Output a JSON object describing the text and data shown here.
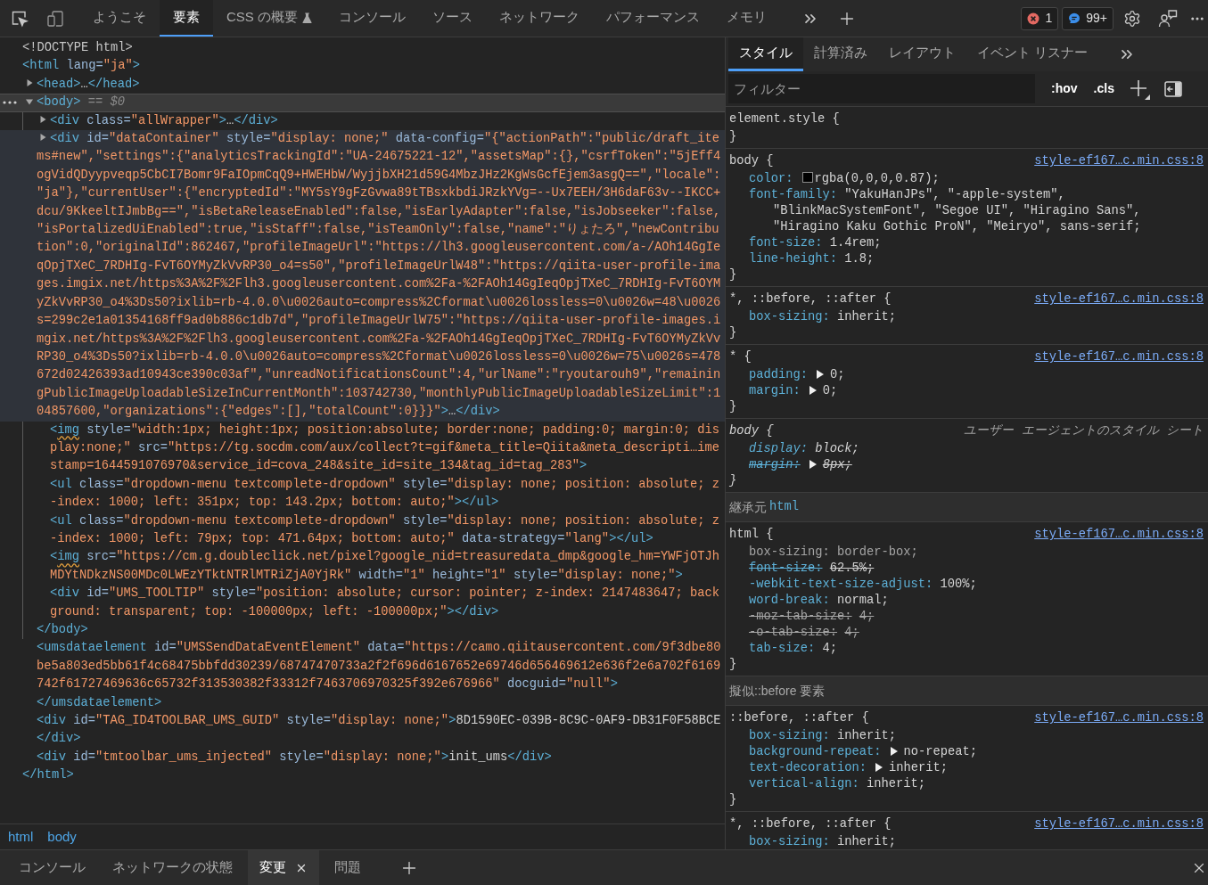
{
  "top_bar": {
    "tabs": [
      {
        "label": "ようこそ",
        "selected": false,
        "experimental": false
      },
      {
        "label": "要素",
        "selected": true,
        "experimental": false
      },
      {
        "label": "CSS の概要",
        "selected": false,
        "experimental": true
      },
      {
        "label": "コンソール",
        "selected": false,
        "experimental": false
      },
      {
        "label": "ソース",
        "selected": false,
        "experimental": false
      },
      {
        "label": "ネットワーク",
        "selected": false,
        "experimental": false
      },
      {
        "label": "パフォーマンス",
        "selected": false,
        "experimental": false
      },
      {
        "label": "メモリ",
        "selected": false,
        "experimental": false
      }
    ],
    "error_count": "1",
    "message_count": "99+"
  },
  "dom_tree": [
    {
      "segments": [
        {
          "kind": "doctype",
          "text": "<!DOCTYPE html>"
        }
      ],
      "selected": false,
      "hovered": false,
      "issue": false
    },
    {
      "segments": [
        {
          "kind": "tag",
          "text": "<html"
        },
        {
          "kind": "attr",
          "text": " lang="
        },
        {
          "kind": "value",
          "text": "\"ja\""
        },
        {
          "kind": "tag",
          "text": ">"
        }
      ],
      "selected": false,
      "hovered": false,
      "issue": false,
      "children": [
        {
          "expanded": false,
          "segments": [
            {
              "kind": "tag",
              "text": "<head>"
            },
            {
              "kind": "text",
              "text": "…"
            },
            {
              "kind": "tag",
              "text": "</head>"
            }
          ],
          "selected": false,
          "hovered": false,
          "issue": false
        },
        {
          "expanded": true,
          "segments": [
            {
              "kind": "tag",
              "text": "<body>"
            },
            {
              "kind": "hint",
              "text": " == $0"
            }
          ],
          "selected": true,
          "hovered": false,
          "issue": false,
          "children": [
            {
              "expanded": false,
              "segments": [
                {
                  "kind": "tag",
                  "text": "<div"
                },
                {
                  "kind": "attr",
                  "text": " class="
                },
                {
                  "kind": "value",
                  "text": "\"allWrapper\""
                },
                {
                  "kind": "tag",
                  "text": ">"
                },
                {
                  "kind": "text",
                  "text": "…"
                },
                {
                  "kind": "tag",
                  "text": "</div>"
                }
              ],
              "selected": false,
              "hovered": false,
              "issue": false
            },
            {
              "expanded": false,
              "segments": [
                {
                  "kind": "tag",
                  "text": "<div"
                },
                {
                  "kind": "attr",
                  "text": " id="
                },
                {
                  "kind": "value",
                  "text": "\"dataContainer\""
                },
                {
                  "kind": "attr",
                  "text": " style="
                },
                {
                  "kind": "value",
                  "text": "\"display: none;\""
                },
                {
                  "kind": "attr",
                  "text": " data-config="
                },
                {
                  "kind": "value",
                  "text": "\"{\"actionPath\":\"public/draft_items#new\",\"settings\":{\"analyticsTrackingId\":\"UA-24675221-12\",\"assetsMap\":{},\"csrfToken\":\"5jEff4ogVidQDyypveqp5CbCI7Bomr9FaIOpmCqQ9+HWEHbW/WyjjbXH21d59G4MbzJHz2KgWsGcfEjem3asgQ==\",\"locale\":\"ja\"},\"currentUser\":{\"encryptedId\":\"MY5sY9gFzGvwa89tTBsxkbdiJRzkYVg=--Ux7EEH/3H6daF63v--IKCC+dcu/9KkeeltIJmbBg==\",\"isBetaReleaseEnabled\":false,\"isEarlyAdapter\":false,\"isJobseeker\":false,\"isPortalizedUiEnabled\":true,\"isStaff\":false,\"isTeamOnly\":false,\"name\":\"りょたろ\",\"newContribution\":0,\"originalId\":862467,\"profileImageUrl\":\"https://lh3.googleusercontent.com/a-/AOh14GgIeqOpjTXeC_7RDHIg-FvT6OYMyZkVvRP30_o4=s50\",\"profileImageUrlW48\":\"https://qiita-user-profile-images.imgix.net/https%3A%2F%2Flh3.googleusercontent.com%2Fa-%2FAOh14GgIeqOpjTXeC_7RDHIg-FvT6OYMyZkVvRP30_o4%3Ds50?ixlib=rb-4.0.0\\u0026auto=compress%2Cformat\\u0026lossless=0\\u0026w=48\\u0026s=299c2e1a01354168ff9ad0b886c1db7d\",\"profileImageUrlW75\":\"https://qiita-user-profile-images.imgix.net/https%3A%2F%2Flh3.googleusercontent.com%2Fa-%2FAOh14GgIeqOpjTXeC_7RDHIg-FvT6OYMyZkVvRP30_o4%3Ds50?ixlib=rb-4.0.0\\u0026auto=compress%2Cformat\\u0026lossless=0\\u0026w=75\\u0026s=478672d02426393ad10943ce390c03af\",\"unreadNotificationsCount\":4,\"urlName\":\"ryoutarouh9\",\"remainingPublicImageUploadableSizeInCurrentMonth\":103742730,\"monthlyPublicImageUploadableSizeLimit\":104857600,\"organizations\":{\"edges\":[],\"totalCount\":0}}}\""
                },
                {
                  "kind": "tag",
                  "text": ">"
                },
                {
                  "kind": "text",
                  "text": "…"
                },
                {
                  "kind": "tag",
                  "text": "</div>"
                }
              ],
              "selected": false,
              "hovered": true,
              "issue": false
            },
            {
              "segments": [
                {
                  "kind": "tag",
                  "text": "<img"
                },
                {
                  "kind": "attr",
                  "text": " style="
                },
                {
                  "kind": "value",
                  "text": "\"width:1px; height:1px; position:absolute; border:none; padding:0; margin:0; display:none;\""
                },
                {
                  "kind": "attr",
                  "text": " src="
                },
                {
                  "kind": "value",
                  "text": "\"https://tg.socdm.com/aux/collect?t=gif&meta_title=Qiita&meta_descripti…imestamp=1644591076970&service_id=cova_248&site_id=site_134&tag_id=tag_283\""
                },
                {
                  "kind": "tag",
                  "text": ">"
                }
              ],
              "selected": false,
              "hovered": false,
              "issue": true
            },
            {
              "segments": [
                {
                  "kind": "tag",
                  "text": "<ul"
                },
                {
                  "kind": "attr",
                  "text": " class="
                },
                {
                  "kind": "value",
                  "text": "\"dropdown-menu textcomplete-dropdown\""
                },
                {
                  "kind": "attr",
                  "text": " style="
                },
                {
                  "kind": "value",
                  "text": "\"display: none; position: absolute; z-index: 1000; left: 351px; top: 143.2px; bottom: auto;\""
                },
                {
                  "kind": "tag",
                  "text": "></ul>"
                }
              ],
              "selected": false,
              "hovered": false,
              "issue": false
            },
            {
              "segments": [
                {
                  "kind": "tag",
                  "text": "<ul"
                },
                {
                  "kind": "attr",
                  "text": " class="
                },
                {
                  "kind": "value",
                  "text": "\"dropdown-menu textcomplete-dropdown\""
                },
                {
                  "kind": "attr",
                  "text": " style="
                },
                {
                  "kind": "value",
                  "text": "\"display: none; position: absolute; z-index: 1000; left: 79px; top: 471.64px; bottom: auto;\""
                },
                {
                  "kind": "attr",
                  "text": " data-strategy="
                },
                {
                  "kind": "value",
                  "text": "\"lang\""
                },
                {
                  "kind": "tag",
                  "text": "></ul>"
                }
              ],
              "selected": false,
              "hovered": false,
              "issue": false
            },
            {
              "segments": [
                {
                  "kind": "tag",
                  "text": "<img"
                },
                {
                  "kind": "attr",
                  "text": " src="
                },
                {
                  "kind": "value",
                  "text": "\"https://cm.g.doubleclick.net/pixel?google_nid=treasuredata_dmp&google_hm=YWFjOTJhMDYtNDkzNS00MDc0LWEzYTktNTRlMTRiZjA0YjRk\""
                },
                {
                  "kind": "attr",
                  "text": " width="
                },
                {
                  "kind": "value",
                  "text": "\"1\""
                },
                {
                  "kind": "attr",
                  "text": " height="
                },
                {
                  "kind": "value",
                  "text": "\"1\""
                },
                {
                  "kind": "attr",
                  "text": " style="
                },
                {
                  "kind": "value",
                  "text": "\"display: none;\""
                },
                {
                  "kind": "tag",
                  "text": ">"
                }
              ],
              "selected": false,
              "hovered": false,
              "issue": true
            },
            {
              "segments": [
                {
                  "kind": "tag",
                  "text": "<div"
                },
                {
                  "kind": "attr",
                  "text": " id="
                },
                {
                  "kind": "value",
                  "text": "\"UMS_TOOLTIP\""
                },
                {
                  "kind": "attr",
                  "text": " style="
                },
                {
                  "kind": "value",
                  "text": "\"position: absolute; cursor: pointer; z-index: 2147483647; background: transparent; top: -100000px; left: -100000px;\""
                },
                {
                  "kind": "tag",
                  "text": "></div>"
                }
              ],
              "selected": false,
              "hovered": false,
              "issue": false
            }
          ],
          "closing": [
            {
              "kind": "tag",
              "text": "</body>"
            }
          ]
        },
        {
          "segments": [
            {
              "kind": "tag",
              "text": "<umsdataelement"
            },
            {
              "kind": "attr",
              "text": " id="
            },
            {
              "kind": "value",
              "text": "\"UMSSendDataEventElement\""
            },
            {
              "kind": "attr",
              "text": " data="
            },
            {
              "kind": "value",
              "text": "\"https://camo.qiitausercontent.com/9f3dbe80be5a803ed5bb61f4c68475bbfdd30239/68747470733a2f2f696d6167652e69746d656469612e636f2e6a702f6169742f61727469636c65732f313530382f33312f7463706970325f392e676966\""
            },
            {
              "kind": "attr",
              "text": " docguid="
            },
            {
              "kind": "value",
              "text": "\"null\""
            },
            {
              "kind": "tag",
              "text": ">"
            }
          ],
          "selected": false,
          "hovered": false,
          "issue": false,
          "closing": [
            {
              "kind": "tag",
              "text": "</umsdataelement>"
            }
          ]
        },
        {
          "segments": [
            {
              "kind": "tag",
              "text": "<div"
            },
            {
              "kind": "attr",
              "text": " id="
            },
            {
              "kind": "value",
              "text": "\"TAG_ID4TOOLBAR_UMS_GUID\""
            },
            {
              "kind": "attr",
              "text": " style="
            },
            {
              "kind": "value",
              "text": "\"display: none;\""
            },
            {
              "kind": "tag",
              "text": ">"
            },
            {
              "kind": "text",
              "text": "8D1590EC-039B-8C9C-0AF9-DB31F0F58BCE"
            }
          ],
          "selected": false,
          "hovered": false,
          "issue": false,
          "closing": [
            {
              "kind": "tag",
              "text": "</div>"
            }
          ]
        },
        {
          "segments": [
            {
              "kind": "tag",
              "text": "<div"
            },
            {
              "kind": "attr",
              "text": " id="
            },
            {
              "kind": "value",
              "text": "\"tmtoolbar_ums_injected\""
            },
            {
              "kind": "attr",
              "text": " style="
            },
            {
              "kind": "value",
              "text": "\"display: none;\""
            },
            {
              "kind": "tag",
              "text": ">"
            },
            {
              "kind": "text",
              "text": "init_ums"
            },
            {
              "kind": "tag",
              "text": "</div>"
            }
          ],
          "selected": false,
          "hovered": false,
          "issue": false
        }
      ],
      "closing": [
        {
          "kind": "tag",
          "text": "</html>"
        }
      ]
    }
  ],
  "breadcrumbs": [
    "html",
    "body"
  ],
  "styles_pane": {
    "tabs": [
      {
        "label": "スタイル",
        "selected": true
      },
      {
        "label": "計算済み",
        "selected": false
      },
      {
        "label": "レイアウト",
        "selected": false
      },
      {
        "label": "イベント リスナー",
        "selected": false
      }
    ],
    "filter": {
      "placeholder": "フィルター"
    },
    "toggles": [
      ":hov",
      ".cls"
    ],
    "blocks": [
      {
        "kind": "rule",
        "user_agent": false,
        "selector": "element.style {",
        "end": "}"
      },
      {
        "kind": "rule",
        "user_agent": false,
        "selector": "body {",
        "source": "style-ef167…c.min.css:8",
        "end": "}",
        "properties": [
          {
            "name": "color:",
            "value": "rgba(0,0,0,0.87);",
            "color": "#000000",
            "struck": false,
            "inactive": false,
            "expandable": false
          },
          {
            "name": "font-family:",
            "value": "\"YakuHanJPs\", \"-apple-system\", \"BlinkMacSystemFont\", \"Segoe UI\", \"Hiragino Sans\", \"Hiragino Kaku Gothic ProN\", \"Meiryo\", sans-serif;",
            "struck": false,
            "inactive": false,
            "expandable": false
          },
          {
            "name": "font-size:",
            "value": "1.4rem;",
            "struck": false,
            "inactive": false,
            "expandable": false
          },
          {
            "name": "line-height:",
            "value": "1.8;",
            "struck": false,
            "inactive": false,
            "expandable": false
          }
        ]
      },
      {
        "kind": "rule",
        "user_agent": false,
        "selector": "*, ::before, ::after {",
        "source": "style-ef167…c.min.css:8",
        "end": "}",
        "properties": [
          {
            "name": "box-sizing:",
            "value": "inherit;",
            "struck": false,
            "inactive": false,
            "expandable": false
          }
        ]
      },
      {
        "kind": "rule",
        "user_agent": false,
        "selector": "* {",
        "source": "style-ef167…c.min.css:8",
        "end": "}",
        "properties": [
          {
            "name": "padding:",
            "value": "0;",
            "struck": false,
            "inactive": false,
            "expandable": true
          },
          {
            "name": "margin:",
            "value": "0;",
            "struck": false,
            "inactive": false,
            "expandable": true
          }
        ]
      },
      {
        "kind": "rule",
        "user_agent": true,
        "selector": "body {",
        "source": "ユーザー エージェントのスタイル シート",
        "end": "}",
        "properties": [
          {
            "name": "display:",
            "value": "block;",
            "struck": false,
            "inactive": false,
            "expandable": false
          },
          {
            "name": "margin:",
            "value": "8px;",
            "struck": true,
            "inactive": false,
            "expandable": true
          }
        ]
      },
      {
        "kind": "header",
        "label": "継承元",
        "link": "html"
      },
      {
        "kind": "rule",
        "user_agent": false,
        "selector": "html {",
        "source": "style-ef167…c.min.css:8",
        "end": "}",
        "properties": [
          {
            "name": "box-sizing:",
            "value": "border-box;",
            "struck": false,
            "inactive": true,
            "expandable": false
          },
          {
            "name": "font-size:",
            "value": "62.5%;",
            "struck": true,
            "inactive": false,
            "expandable": false
          },
          {
            "name": "-webkit-text-size-adjust:",
            "value": "100%;",
            "struck": false,
            "inactive": false,
            "expandable": false
          },
          {
            "name": "word-break:",
            "value": "normal;",
            "struck": false,
            "inactive": false,
            "expandable": false
          },
          {
            "name": "-moz-tab-size:",
            "value": "4;",
            "struck": true,
            "inactive": true,
            "expandable": false
          },
          {
            "name": "-o-tab-size:",
            "value": "4;",
            "struck": true,
            "inactive": true,
            "expandable": false
          },
          {
            "name": "tab-size:",
            "value": "4;",
            "struck": false,
            "inactive": false,
            "expandable": false
          }
        ]
      },
      {
        "kind": "header",
        "label": "擬似::before 要素"
      },
      {
        "kind": "rule",
        "user_agent": false,
        "selector": "::before, ::after {",
        "source": "style-ef167…c.min.css:8",
        "end": "}",
        "properties": [
          {
            "name": "box-sizing:",
            "value": "inherit;",
            "struck": false,
            "inactive": false,
            "expandable": false
          },
          {
            "name": "background-repeat:",
            "value": "no-repeat;",
            "struck": false,
            "inactive": false,
            "expandable": true
          },
          {
            "name": "text-decoration:",
            "value": "inherit;",
            "struck": false,
            "inactive": false,
            "expandable": true
          },
          {
            "name": "vertical-align:",
            "value": "inherit;",
            "struck": false,
            "inactive": false,
            "expandable": false
          }
        ]
      },
      {
        "kind": "rule",
        "user_agent": false,
        "selector": "*, ::before, ::after {",
        "source": "style-ef167…c.min.css:8",
        "properties": [
          {
            "name": "box-sizing:",
            "value": "inherit;",
            "struck": false,
            "inactive": false,
            "expandable": false
          }
        ]
      }
    ]
  },
  "drawer": {
    "tabs": [
      {
        "label": "コンソール",
        "selected": false
      },
      {
        "label": "ネットワークの状態",
        "selected": false
      },
      {
        "label": "変更",
        "selected": true
      },
      {
        "label": "問題",
        "selected": false
      }
    ]
  }
}
